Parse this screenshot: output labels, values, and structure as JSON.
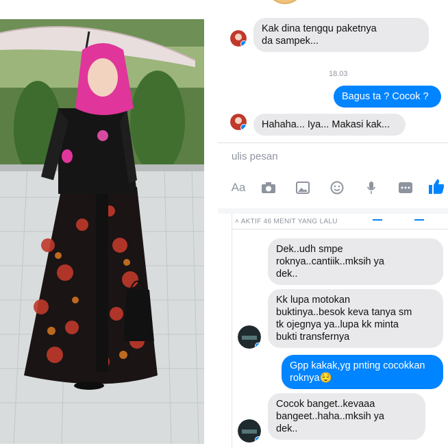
{
  "top_chat": {
    "messages": [
      {
        "from": "them",
        "text": "Kak dina tengqu paketnya\nda sampek..."
      },
      {
        "from": "me",
        "text": "Bagus ta ? Cocok ?"
      },
      {
        "from": "them",
        "text": "Hahaha... Iya... Makasi kak..."
      }
    ],
    "timestamp": "18.03",
    "composer_placeholder": "ulis pesan",
    "toolbar": {
      "aa_label": "Aa",
      "icons": [
        "camera-icon",
        "gallery-icon",
        "emoji-icon",
        "microphone-icon",
        "more-icon",
        "thumbs-up-icon"
      ]
    }
  },
  "bottom_chat": {
    "active_status": "AKTIF 46 MENIT YANG LALU",
    "messages": [
      {
        "from": "them",
        "text": "Dek..udh smpe\nroknya..cantiik..mksih ya\ndek.."
      },
      {
        "from": "them",
        "text": "Kk lupa motokan\nbuktinya..besok keva tanya sm\ntk ojegnya ya..lupa kk minta\nbukti transfernya"
      },
      {
        "from": "me",
        "text": "Gpp kakak,yg pnting cocokkan\nroknya😌"
      },
      {
        "from": "them",
        "text": "Cocok banget..kevaaa\nbangeet..haha..mksih ya\ndek.."
      }
    ]
  },
  "colors": {
    "messenger_blue": "#0084ff",
    "incoming_bubble": "#e9e9eb",
    "hijab": "#e0359b",
    "skirt_base": "#1a1414",
    "skirt_pattern": "#c0392b"
  }
}
